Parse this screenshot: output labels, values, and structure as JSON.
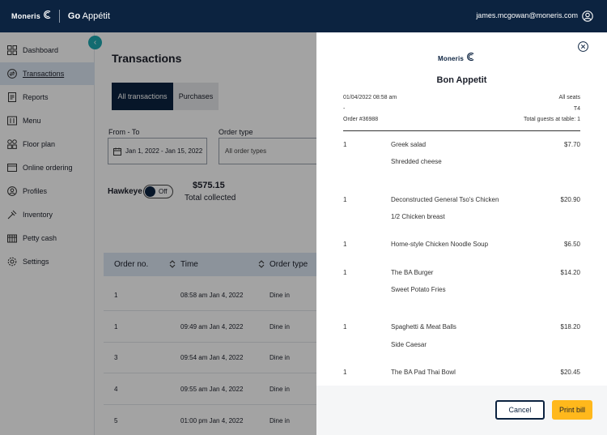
{
  "topbar": {
    "brand": "Moneris",
    "product_bold": "Go",
    "product_rest": " Appétit",
    "user_email": "james.mcgowan@moneris.com"
  },
  "sidebar": {
    "items": [
      {
        "label": "Dashboard",
        "icon": "dashboard-icon"
      },
      {
        "label": "Transactions",
        "icon": "transactions-icon",
        "active": true
      },
      {
        "label": "Reports",
        "icon": "reports-icon"
      },
      {
        "label": "Menu",
        "icon": "menu-icon"
      },
      {
        "label": "Floor plan",
        "icon": "floor-plan-icon"
      },
      {
        "label": "Online ordering",
        "icon": "online-ordering-icon"
      },
      {
        "label": "Profiles",
        "icon": "profiles-icon"
      },
      {
        "label": "Inventory",
        "icon": "inventory-icon"
      },
      {
        "label": "Petty cash",
        "icon": "petty-cash-icon"
      },
      {
        "label": "Settings",
        "icon": "settings-icon"
      }
    ],
    "collapse_glyph": "‹"
  },
  "main": {
    "title": "Transactions",
    "tabs": [
      {
        "label": "All transactions",
        "selected": true
      },
      {
        "label": "Purchases",
        "selected": false
      }
    ],
    "filters": {
      "date_label": "From - To",
      "date_value": "Jan 1, 2022 - Jan 15, 2022",
      "order_type_label": "Order type",
      "order_type_value": "All order types"
    },
    "hawkeye": {
      "label": "Hawkeye",
      "toggle_text": "Off"
    },
    "total": {
      "amount": "$575.15",
      "label": "Total collected"
    },
    "table": {
      "headers": [
        "Order no.",
        "Time",
        "Order type"
      ],
      "rows": [
        {
          "order": "1",
          "time": "08:58 am Jan 4, 2022",
          "type": "Dine in"
        },
        {
          "order": "1",
          "time": "09:49 am Jan 4, 2022",
          "type": "Dine in"
        },
        {
          "order": "3",
          "time": "09:54 am Jan 4, 2022",
          "type": "Dine in"
        },
        {
          "order": "4",
          "time": "09:55 am Jan 4, 2022",
          "type": "Dine in"
        },
        {
          "order": "5",
          "time": "01:00 pm Jan 4, 2022",
          "type": "Dine in"
        }
      ]
    }
  },
  "receipt": {
    "brand": "Moneris",
    "restaurant": "Bon Appetit",
    "datetime": "01/04/2022 08:58 am",
    "seats": "All seats",
    "dash": "-",
    "table": "T4",
    "order_no": "Order #36988",
    "guests": "Total guests at table: 1",
    "items": [
      {
        "qty": "1",
        "name": "Greek salad",
        "price": "$7.70",
        "modifier": "Shredded cheese"
      },
      {
        "qty": "1",
        "name": "Deconstructed General Tso's Chicken",
        "price": "$20.90",
        "modifier": "1/2 Chicken breast"
      },
      {
        "qty": "1",
        "name": "Home-style Chicken Noodle Soup",
        "price": "$6.50",
        "modifier": ""
      },
      {
        "qty": "1",
        "name": "The BA Burger",
        "price": "$14.20",
        "modifier": "Sweet Potato Fries"
      },
      {
        "qty": "1",
        "name": "Spaghetti & Meat Balls",
        "price": "$18.20",
        "modifier": "Side Caesar"
      },
      {
        "qty": "1",
        "name": "The BA Pad Thai Bowl",
        "price": "$20.45",
        "modifier": ""
      }
    ],
    "cancel_label": "Cancel",
    "print_label": "Print bill"
  },
  "colors": {
    "navy": "#0c2340",
    "accent_teal": "#1ea8b0",
    "print_yellow": "#ffb81c",
    "active_nav_bg": "#dce6f3"
  }
}
